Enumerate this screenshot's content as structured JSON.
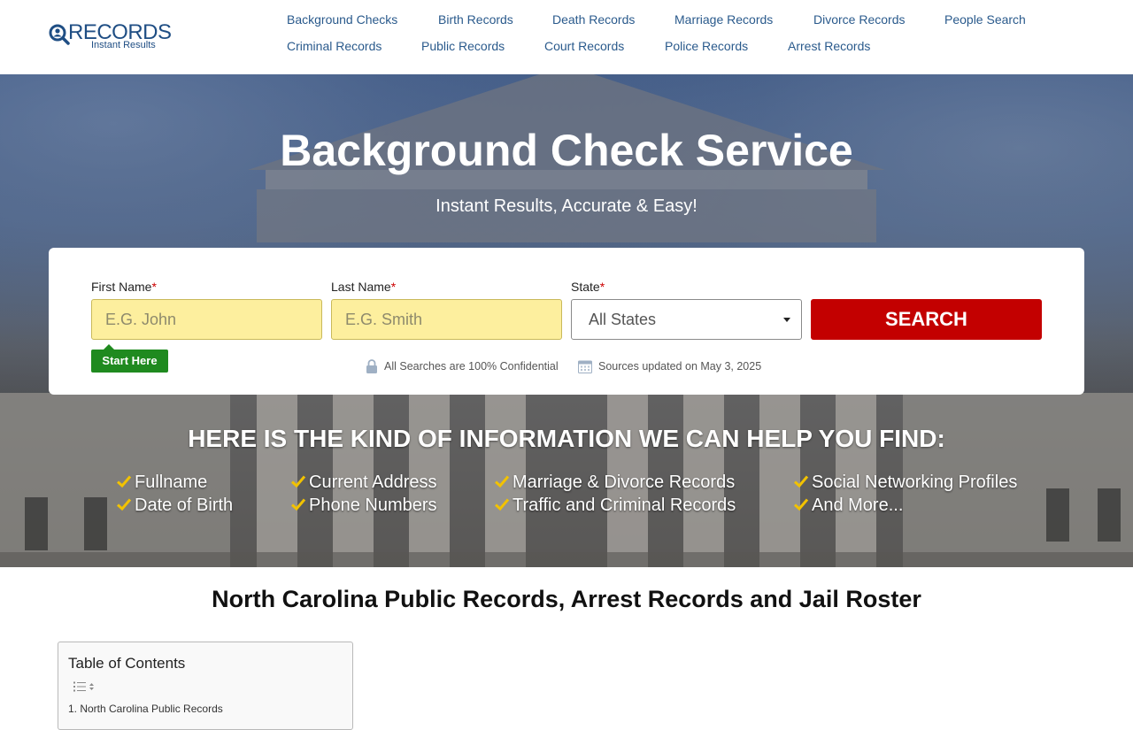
{
  "logo": {
    "word": "RECORDS",
    "tagline": "Instant Results"
  },
  "nav": {
    "row1": [
      "Background Checks",
      "Birth Records",
      "Death Records",
      "Marriage Records",
      "Divorce Records",
      "People Search"
    ],
    "row2": [
      "Criminal Records",
      "Public Records",
      "Court Records",
      "Police Records",
      "Arrest Records"
    ]
  },
  "hero": {
    "title": "Background Check Service",
    "subtitle": "Instant Results, Accurate & Easy!"
  },
  "search": {
    "first_name_label": "First Name",
    "last_name_label": "Last Name",
    "state_label": "State",
    "required_mark": "*",
    "first_name_placeholder": "E.G. John",
    "last_name_placeholder": "E.G. Smith",
    "state_value": "All States",
    "button": "SEARCH",
    "start_badge": "Start Here",
    "confidential": "All Searches are 100% Confidential",
    "updated": "Sources updated on May 3, 2025"
  },
  "info": {
    "title": "HERE IS THE KIND OF INFORMATION WE CAN HELP YOU FIND:",
    "items": [
      "Fullname",
      "Date of Birth",
      "Current Address",
      "Phone Numbers",
      "Marriage & Divorce Records",
      "Traffic and Criminal Records",
      "Social Networking Profiles",
      "And More..."
    ]
  },
  "main": {
    "heading": "North Carolina Public Records, Arrest Records and Jail Roster"
  },
  "toc": {
    "title": "Table of Contents",
    "first_item": "1. North Carolina Public Records"
  },
  "colors": {
    "nav_link": "#2a5a8c",
    "search_button": "#c30000",
    "input_bg": "#fdef9e",
    "start_badge": "#1f8a1f",
    "check": "#f2c200"
  },
  "icons": [
    "magnifier-person-icon",
    "lock-icon",
    "calendar-icon",
    "check-icon",
    "chevron-down-icon",
    "list-toggle-icon"
  ]
}
